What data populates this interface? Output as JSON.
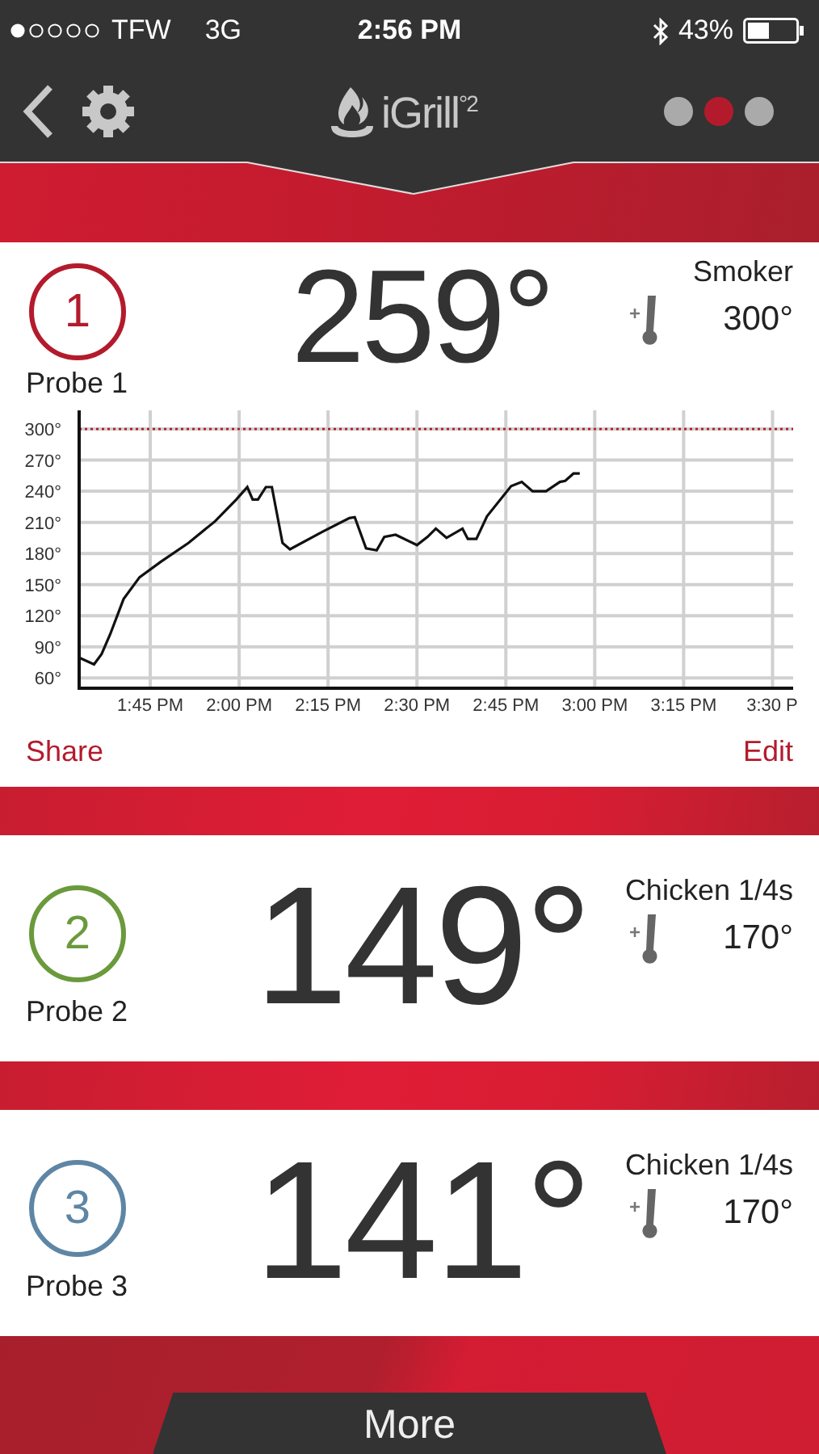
{
  "status_bar": {
    "carrier": "TFW",
    "network": "3G",
    "time": "2:56 PM",
    "battery": "43%"
  },
  "nav": {
    "logo": "iGrill$^{°2}$",
    "page_dots": [
      {
        "selected": false
      },
      {
        "selected": true
      },
      {
        "selected": false
      }
    ]
  },
  "probes": [
    {
      "number": "1",
      "name": "Probe 1",
      "color": "#b31b2c",
      "temperature": "259°",
      "preset": "Smoker",
      "target": "300°",
      "actions": [
        "Share",
        "Edit"
      ],
      "chart_data": {
        "type": "line",
        "x": [
          13.553,
          13.592,
          13.613,
          13.637,
          13.675,
          13.72,
          13.78,
          13.857,
          13.932,
          13.992,
          14.023,
          14.038,
          14.053,
          14.075,
          14.092,
          14.122,
          14.143,
          14.235,
          14.31,
          14.325,
          14.357,
          14.387,
          14.408,
          14.44,
          14.5,
          14.53,
          14.553,
          14.583,
          14.628,
          14.643,
          14.667,
          14.697,
          14.765,
          14.795,
          14.825,
          14.863,
          14.902,
          14.917,
          14.94,
          14.958
        ],
        "series": [
          {
            "color": "#111111",
            "values": [
              79,
              73,
              83,
              102,
              136,
              157,
              172,
              190,
              211,
              232,
              244,
              232,
              232,
              244,
              244,
              190,
              184,
              201,
              214,
              215,
              185,
              183,
              196,
              198,
              188,
              196,
              204,
              195,
              204,
              194,
              194,
              216,
              245,
              249,
              240,
              240,
              249,
              250,
              257,
              257
            ]
          }
        ],
        "xlim": [
          13.55,
          15.558
        ],
        "ylim": [
          50,
          318
        ],
        "xticks": [
          {
            "value": 13.75,
            "label": "1:45 PM"
          },
          {
            "value": 14,
            "label": "2:00 PM"
          },
          {
            "value": 14.25,
            "label": "2:15 PM"
          },
          {
            "value": 14.5,
            "label": "2:30 PM"
          },
          {
            "value": 14.75,
            "label": "2:45 PM"
          },
          {
            "value": 15,
            "label": "3:00 PM"
          },
          {
            "value": 15.25,
            "label": "3:15 PM"
          },
          {
            "value": 15.5,
            "label": "3:30 P"
          }
        ],
        "yticks": [
          {
            "value": 60,
            "label": "60°"
          },
          {
            "value": 90,
            "label": "90°"
          },
          {
            "value": 120,
            "label": "120°"
          },
          {
            "value": 150,
            "label": "150°"
          },
          {
            "value": 180,
            "label": "180°"
          },
          {
            "value": 210,
            "label": "210°"
          },
          {
            "value": 240,
            "label": "240°"
          },
          {
            "value": 270,
            "label": "270°"
          },
          {
            "value": 300,
            "label": "300°"
          }
        ],
        "grid": true,
        "ref_lines": [
          {
            "axis": "y",
            "value": 300,
            "color": "#b31b2c"
          }
        ]
      }
    },
    {
      "number": "2",
      "name": "Probe 2",
      "color": "#6a9a3c",
      "temperature": "149°",
      "preset": "Chicken 1/4s",
      "target": "170°"
    },
    {
      "number": "3",
      "name": "Probe 3",
      "color": "#5e86a4",
      "temperature": "141°",
      "preset": "Chicken 1/4s",
      "target": "170°"
    }
  ],
  "more_button": "More"
}
